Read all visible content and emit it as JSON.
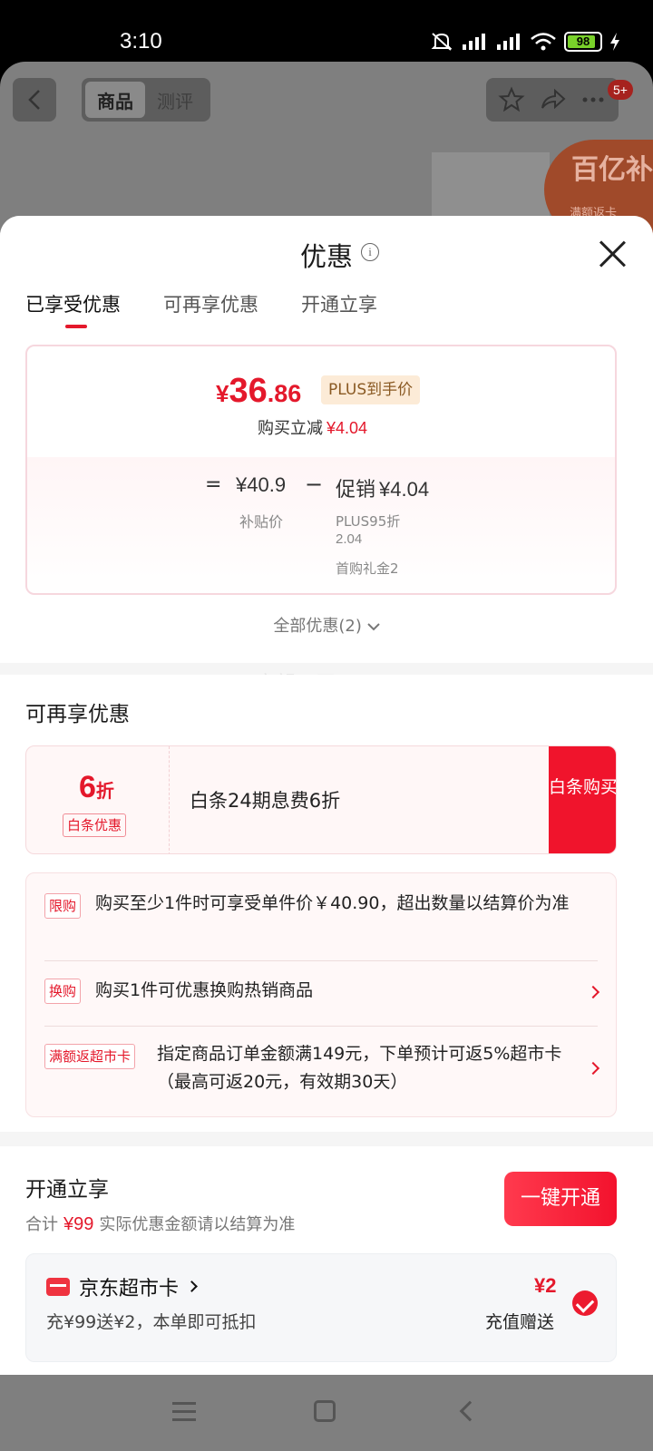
{
  "status_bar": {
    "time": "3:10",
    "battery": "98"
  },
  "background_page": {
    "tabs": [
      "商品",
      "测评"
    ],
    "badge": "5+",
    "sticker_line1": "百亿补贴",
    "sticker_line2": "满额返卡"
  },
  "sheet": {
    "title": "优惠",
    "info_glyph": "i",
    "tabs": [
      "已享受优惠",
      "可再享优惠",
      "开通立享"
    ],
    "price_card": {
      "currency": "¥",
      "price_int": "36",
      "price_dec": ".86",
      "plus_tag": "PLUS到手价",
      "reduce_label": "购买立减",
      "reduce_amount": "¥4.04",
      "equals": "=",
      "subsidy_price": "¥40.9",
      "subsidy_label": "补贴价",
      "minus": "−",
      "promo_label": "促销",
      "promo_amount": "¥4.04",
      "promo_detail_1": "PLUS95折",
      "promo_detail_2": "2.04",
      "promo_detail_3": "首购礼金2"
    },
    "all_promos": "全部优惠(2)",
    "watermark": "守望云天"
  },
  "more_offers": {
    "title": "可再享优惠",
    "baitiao": {
      "zhe_num": "6",
      "zhe_unit": "折",
      "tag": "白条优惠",
      "desc": "白条24期息费6折",
      "button": "白条购买"
    },
    "rules": [
      {
        "tag": "限购",
        "text": "购买至少1件时可享受单件价￥40.90，超出数量以结算价为准"
      },
      {
        "tag": "换购",
        "text": "购买1件可优惠换购热销商品"
      },
      {
        "tag": "满额返超市卡",
        "text": "指定商品订单金额满149元，下单预计可返5%超市卡（最高可返20元，有效期30天）"
      }
    ]
  },
  "open_section": {
    "title": "开通立享",
    "sum_prefix": "合计",
    "sum_amount": "¥99",
    "sum_suffix": "实际优惠金额请以结算为准",
    "button": "一键开通",
    "card": {
      "name": "京东超市卡",
      "desc": "充¥99送¥2，本单即可抵扣",
      "amount": "¥2",
      "amount_label": "充值赠送"
    }
  },
  "colors": {
    "accent": "#e4182b",
    "plus_tag_bg": "#fcebd7"
  }
}
